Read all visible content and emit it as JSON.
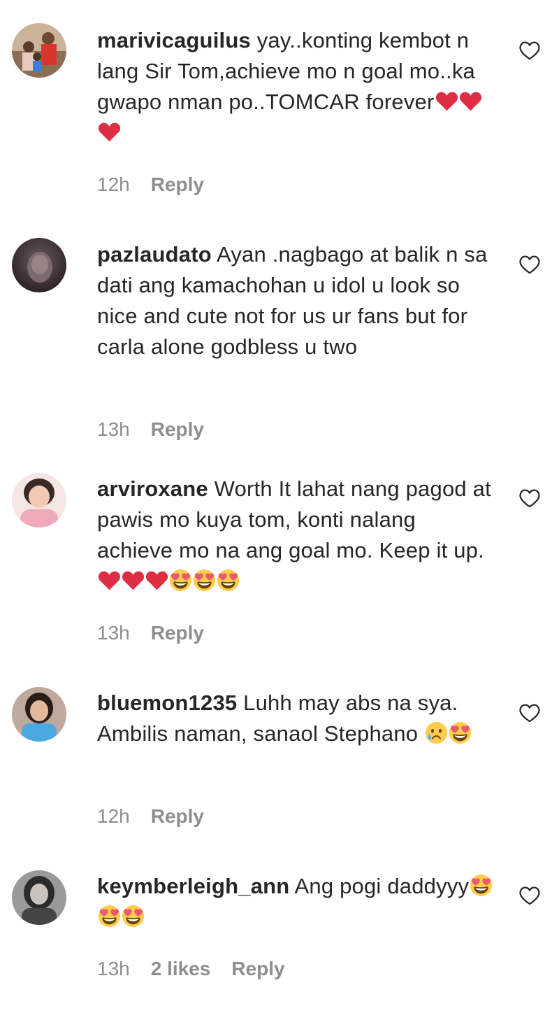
{
  "comments": [
    {
      "username": "marivicaguilus",
      "text": " yay..konting kembot n lang Sir Tom,achieve mo n goal mo..ka gwapo nman po..TOMCAR forever",
      "emojis": [
        "red-heart",
        "red-heart",
        "red-heart"
      ],
      "time": "12h",
      "likes": "",
      "reply": "Reply",
      "avatar": "family-photo-avatar"
    },
    {
      "username": "pazlaudato",
      "text": " Ayan .nagbago at balik n sa dati ang kamachohan u idol u look so nice and cute not for us ur fans but for carla alone godbless u two",
      "emojis": [],
      "time": "13h",
      "likes": "",
      "reply": "Reply",
      "avatar": "dark-portrait-avatar"
    },
    {
      "username": "arviroxane",
      "text": " Worth It lahat nang pagod at pawis mo kuya tom, konti nalang achieve mo na ang goal mo. Keep it up. ",
      "emojis": [
        "red-heart",
        "red-heart",
        "red-heart",
        "heart-eyes",
        "heart-eyes",
        "heart-eyes"
      ],
      "time": "13h",
      "likes": "",
      "reply": "Reply",
      "avatar": "pink-shirt-avatar"
    },
    {
      "username": "bluemon1235",
      "text": " Luhh may abs na sya. Ambilis naman, sanaol Stephano ",
      "emojis": [
        "crying-face",
        "heart-eyes"
      ],
      "time": "12h",
      "likes": "",
      "reply": "Reply",
      "avatar": "blue-shirt-avatar"
    },
    {
      "username": "keymberleigh_ann",
      "text": " Ang pogi daddyyy",
      "emojis": [
        "heart-eyes",
        "heart-eyes",
        "heart-eyes"
      ],
      "time": "13h",
      "likes": "2 likes",
      "reply": "Reply",
      "avatar": "gray-portrait-avatar"
    }
  ],
  "icons": {
    "like": "heart-outline-icon"
  },
  "colors": {
    "text": "#262626",
    "meta": "#8e8e8e",
    "heart_red": "#e0245e",
    "emoji_yellow": "#ffcc4d"
  }
}
